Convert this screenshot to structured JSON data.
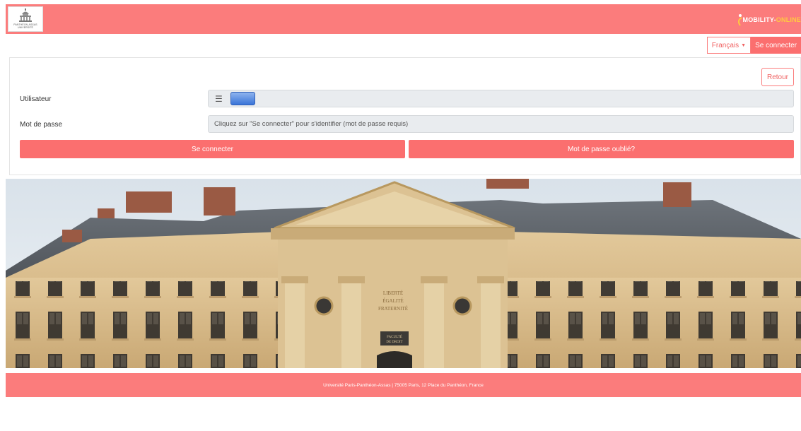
{
  "header": {
    "university_logo_text": "PANTHÉON-ASSAS UNIVERSITÉ",
    "mobility_logo_part1": "MOBILITY-",
    "mobility_logo_part2": "ONLINE"
  },
  "topnav": {
    "language_label": "Français",
    "login_label": "Se connecter"
  },
  "form": {
    "back_label": "Retour",
    "user_label": "Utilisateur",
    "password_label": "Mot de passe",
    "password_placeholder": "Cliquez sur \"Se connecter\" pour s'identifier (mot de passe requis)",
    "login_button": "Se connecter",
    "forgot_button": "Mot de passe oublié?"
  },
  "banner": {
    "motto_line1": "LIBERTÉ",
    "motto_line2": "ÉGALITÉ",
    "motto_line3": "FRATERNITÉ",
    "plaque_line1": "FACULTÉ",
    "plaque_line2": "DE DROIT"
  },
  "footer": {
    "text": "Université Paris-Panthéon-Assas | 75005 Paris, 12 Place du Panthéon, France"
  },
  "colors": {
    "brand": "#fb7c7c",
    "button": "#fb6f6f",
    "field_bg": "#e9ecef",
    "chip": "#3a74d8"
  },
  "icons": [
    "pantheon-logo-icon",
    "hamburger-icon",
    "caret-down-icon",
    "mobility-swoosh-icon"
  ]
}
